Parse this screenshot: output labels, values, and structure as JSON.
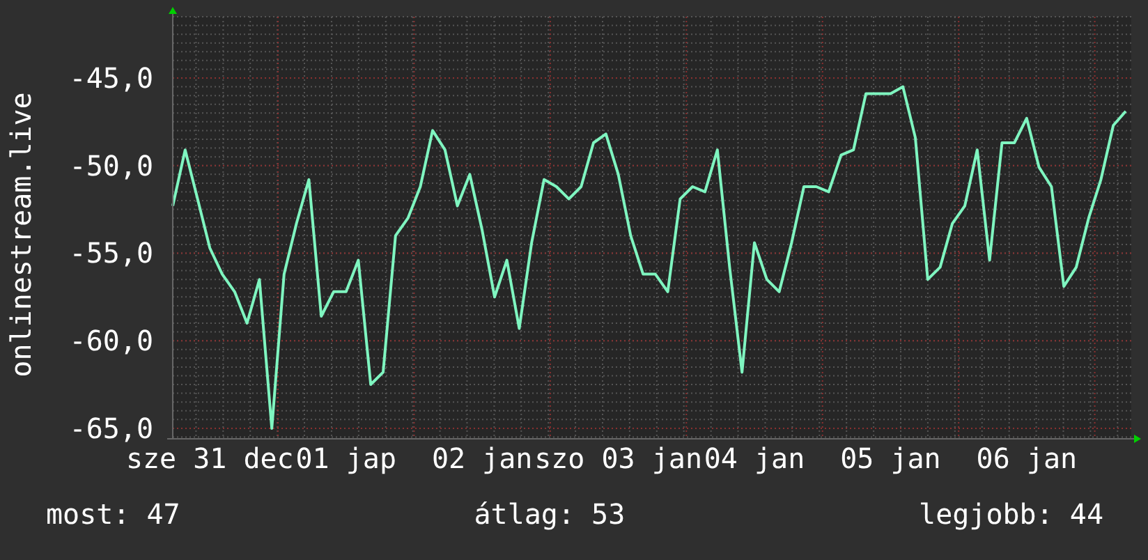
{
  "chart": {
    "chart_data": {
      "type": "line",
      "ylabel": "onlinestream.live",
      "categories": [
        null,
        null,
        null,
        "sze 31 dec",
        null,
        null,
        null,
        null,
        null,
        null,
        null,
        null,
        null,
        null,
        "01 jap",
        null,
        null,
        null,
        null,
        null,
        null,
        null,
        null,
        null,
        null,
        "02 jan",
        null,
        null,
        null,
        null,
        null,
        null,
        null,
        null,
        null,
        null,
        "szo 03 jan",
        null,
        null,
        null,
        null,
        null,
        null,
        null,
        null,
        null,
        null,
        "04 jan",
        null,
        null,
        null,
        null,
        null,
        null,
        null,
        null,
        null,
        null,
        "05 jan",
        null,
        null,
        null,
        null,
        null,
        null,
        null,
        null,
        null,
        null,
        "06 jan",
        null,
        null,
        null,
        null,
        null,
        null,
        null,
        null
      ],
      "series": [
        {
          "color": "#7ff5c0",
          "values": [
            -52.3,
            -49.1,
            -51.9,
            -54.7,
            -56.2,
            -57.2,
            -59,
            -56.5,
            -65,
            -56.2,
            -53.3,
            -50.8,
            -58.6,
            -57.2,
            -57.2,
            -55.4,
            -62.5,
            -61.8,
            -54,
            -53,
            -51.2,
            -48,
            -49.1,
            -52.3,
            -50.5,
            -53.7,
            -57.5,
            -55.4,
            -59.3,
            -54.4,
            -50.8,
            -51.2,
            -51.9,
            -51.2,
            -48.7,
            -48.2,
            -50.5,
            -54,
            -56.2,
            -56.2,
            -57.2,
            -51.9,
            -51.2,
            -51.5,
            -49.1,
            -55.8,
            -61.8,
            -54.4,
            -56.5,
            -57.2,
            -54.4,
            -51.2,
            -51.2,
            -51.5,
            -49.4,
            -49.1,
            -45.9,
            -45.9,
            -45.9,
            -45.5,
            -48.4,
            -56.5,
            -55.8,
            -53.3,
            -52.3,
            -49.1,
            -55.4,
            -48.7,
            -48.7,
            -47.3,
            -50.1,
            -51.2,
            -56.9,
            -55.8,
            -53,
            -50.8,
            -47.7,
            -46.9
          ]
        }
      ],
      "ylim": [
        -65.6,
        -41.5
      ],
      "grid": true,
      "yticks": [
        {
          "value": -45,
          "label": "-45,0"
        },
        {
          "value": -50,
          "label": "-50,0"
        },
        {
          "value": -55,
          "label": "-55,0"
        },
        {
          "value": -60,
          "label": "-60,0"
        },
        {
          "value": -65,
          "label": "-65,0"
        }
      ]
    }
  },
  "legend": [
    {
      "text": "most: 47"
    },
    {
      "text": "átlag: 53"
    },
    {
      "text": "legjobb: 44"
    }
  ]
}
